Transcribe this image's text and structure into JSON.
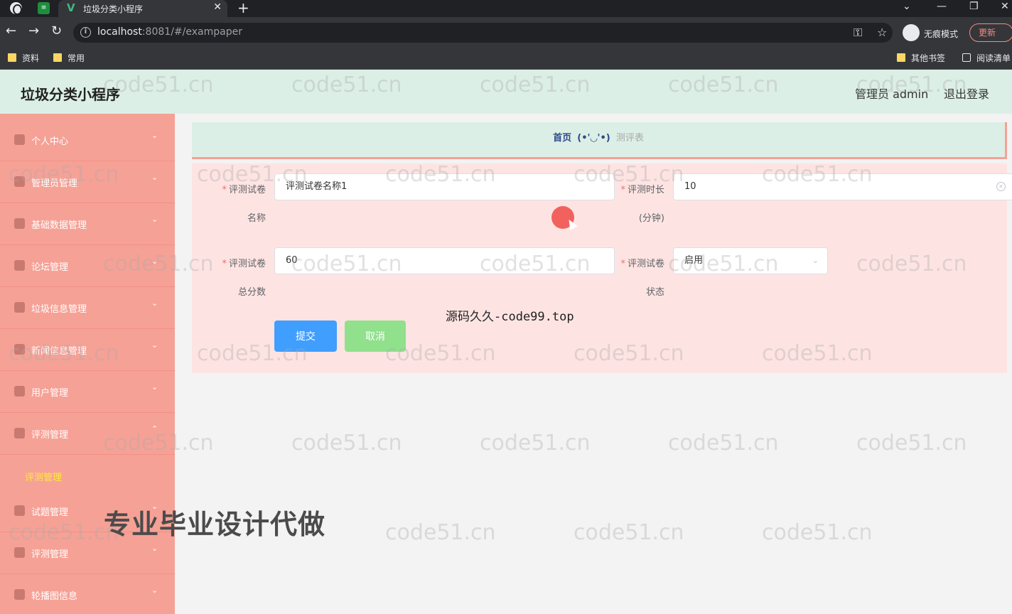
{
  "browser": {
    "tab_title": "垃圾分类小程序",
    "url_host": "localhost",
    "url_rest": ":8081/#/exampaper",
    "incognito_label": "无痕模式",
    "update_label": "更新",
    "bookmarks": [
      "资料",
      "常用"
    ],
    "other_bookmarks": "其他书签",
    "reading_list": "阅读清单"
  },
  "header": {
    "title": "垃圾分类小程序",
    "user": "管理员 admin",
    "logout": "退出登录"
  },
  "sidebar": {
    "items": [
      {
        "label": "个人中心",
        "icon": "user-icon"
      },
      {
        "label": "管理员管理",
        "icon": "admin-icon"
      },
      {
        "label": "基础数据管理",
        "icon": "data-icon"
      },
      {
        "label": "论坛管理",
        "icon": "forum-icon"
      },
      {
        "label": "垃圾信息管理",
        "icon": "trash-icon"
      },
      {
        "label": "新闻信息管理",
        "icon": "news-icon"
      },
      {
        "label": "用户管理",
        "icon": "send-icon"
      },
      {
        "label": "评测管理",
        "icon": "mail-icon"
      },
      {
        "label": "试题管理",
        "icon": "settings-icon"
      },
      {
        "label": "评测管理",
        "icon": "edit-icon"
      },
      {
        "label": "轮播图信息",
        "icon": "carousel-icon"
      }
    ],
    "active_sub": "评测管理"
  },
  "breadcrumb": {
    "home": "首页",
    "face": "(•'◡'•)",
    "current": "测评表"
  },
  "form": {
    "name_label_1": "评测试卷",
    "name_label_2": "名称",
    "name_value": "评测试卷名称1",
    "duration_label_1": "评测时长",
    "duration_label_2": "(分钟)",
    "duration_value": "10",
    "score_label_1": "评测试卷",
    "score_label_2": "总分数",
    "score_value": "60",
    "status_label_1": "评测试卷",
    "status_label_2": "状态",
    "status_value": "启用",
    "submit": "提交",
    "cancel": "取消"
  },
  "overlays": {
    "source": "源码久久-code99.top",
    "ad": "专业毕业设计代做",
    "watermark": "code51.cn"
  },
  "colors": {
    "sidebar": "#f6a196",
    "header": "#dcefe6",
    "submit": "#409eff",
    "cancel": "#90e08c",
    "active_sub": "#ffea3d"
  }
}
